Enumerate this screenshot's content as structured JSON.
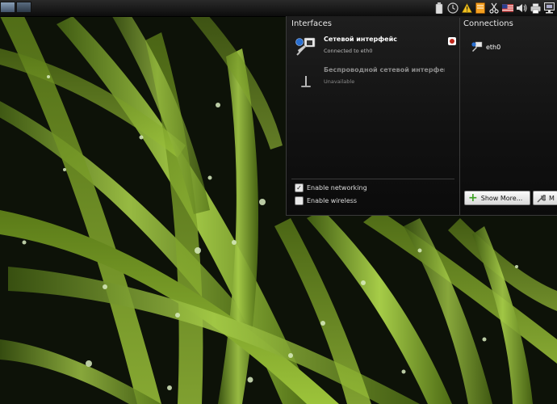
{
  "colors": {
    "panel": "#111111",
    "popup": "#141414",
    "grass": "#7aa520",
    "accent_green": "#3aa020"
  },
  "interfaces": {
    "title": "Interfaces",
    "items": [
      {
        "name": "Сетевой интерфейс",
        "status": "Connected to eth0",
        "icon": "wired-network-icon"
      },
      {
        "name": "Беспроводной сетевой интерфейс",
        "status": "Unavailable",
        "icon": "wireless-network-icon"
      }
    ],
    "enable_networking": "Enable networking",
    "enable_wireless": "Enable wireless",
    "networking_checked": true,
    "wireless_checked": false
  },
  "connections": {
    "title": "Connections",
    "items": [
      {
        "name": "eth0",
        "icon": "network-connection-icon"
      }
    ],
    "show_more": "Show More...",
    "manage": "M"
  },
  "tray": {
    "icons": [
      "battery-icon",
      "clock-icon",
      "warning-icon",
      "notes-icon",
      "clipboard-scissors-icon",
      "keyboard-layout-us-flag-icon",
      "volume-icon",
      "printer-icon",
      "network-icon"
    ]
  }
}
